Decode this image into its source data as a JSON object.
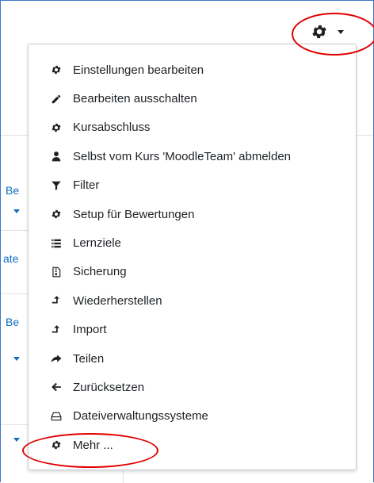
{
  "background": {
    "partial_labels": [
      "Be",
      "ate",
      "Be"
    ]
  },
  "header": {
    "gear_icon": "gear-icon"
  },
  "menu": {
    "items": [
      {
        "label": "Einstellungen bearbeiten",
        "icon": "gear-icon"
      },
      {
        "label": "Bearbeiten ausschalten",
        "icon": "pencil-icon"
      },
      {
        "label": "Kursabschluss",
        "icon": "gear-icon"
      },
      {
        "label": "Selbst vom Kurs 'MoodleTeam' abmelden",
        "icon": "user-icon"
      },
      {
        "label": "Filter",
        "icon": "filter-icon"
      },
      {
        "label": "Setup für Bewertungen",
        "icon": "gear-icon"
      },
      {
        "label": "Lernziele",
        "icon": "list-icon"
      },
      {
        "label": "Sicherung",
        "icon": "archive-file-icon"
      },
      {
        "label": "Wiederherstellen",
        "icon": "upload-arrow-icon"
      },
      {
        "label": "Import",
        "icon": "upload-arrow-icon"
      },
      {
        "label": "Teilen",
        "icon": "share-icon"
      },
      {
        "label": "Zurücksetzen",
        "icon": "arrow-left-icon"
      },
      {
        "label": "Dateiverwaltungssysteme",
        "icon": "drive-icon"
      },
      {
        "label": "Mehr ...",
        "icon": "gear-icon"
      }
    ]
  },
  "colors": {
    "accent": "#0f6cbf",
    "annotation": "#e00000",
    "frame": "#3c78c8"
  }
}
